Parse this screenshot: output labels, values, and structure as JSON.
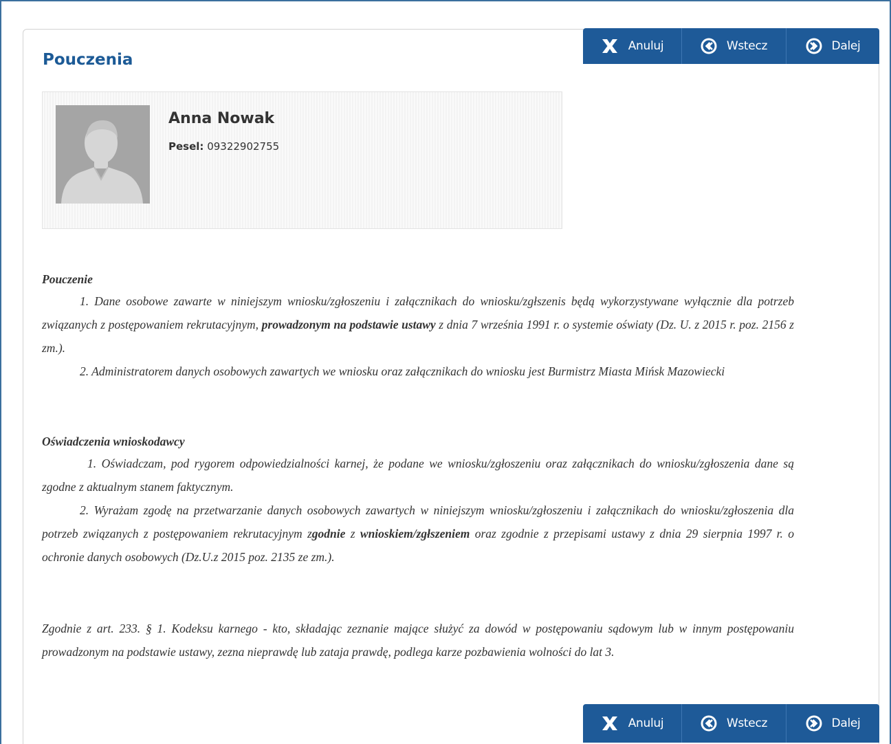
{
  "page": {
    "title": "Pouczenia"
  },
  "toolbar": {
    "cancel_label": "Anuluj",
    "back_label": "Wstecz",
    "next_label": "Dalej"
  },
  "profile": {
    "name": "Anna Nowak",
    "pesel_label": "Pesel:",
    "pesel_value": "09322902755"
  },
  "pouczenie": {
    "heading": "Pouczenie",
    "item1_a": "1. Dane osobowe zawarte w niniejszym wniosku/zgłoszeniu i załącznikach do wniosku/zgłszenis będą wykorzystywane wyłącznie dla potrzeb związanych z postępowaniem rekrutacyjnym, ",
    "item1_b": "prowadzonym na podstawie ustawy",
    "item1_c": "  z dnia 7 września 1991 r. o systemie oświaty (Dz. U. z 2015 r. poz. 2156 z zm.).",
    "item2": "2. Administratorem danych osobowych zawartych we wniosku oraz załącznikach do wniosku jest Burmistrz Miasta Mińsk Mazowiecki"
  },
  "oswiadczenia": {
    "heading": "Oświadczenia wnioskodawcy",
    "item1": "1.  Oświadczam, pod rygorem odpowiedzialności karnej, że podane we wniosku/zgłoszeniu oraz załącznikach do wniosku/zgłoszenia dane są zgodne z aktualnym stanem faktycznym.",
    "item2_a": "2.  Wyrażam zgodę na przetwarzanie danych osobowych zawartych w niniejszym wniosku/zgłoszeniu i załącznikach do wniosku/zgłoszenia dla potrzeb związanych z postępowaniem rekrutacyjnym z",
    "item2_b": "godnie",
    "item2_c": " z ",
    "item2_d": "wnioskiem/zgłszeniem",
    "item2_e": " oraz zgodnie z przepisami ustawy z dnia 29 sierpnia 1997 r. o ochronie danych osobowych (Dz.U.z 2015 poz. 2135 ze zm.)."
  },
  "kodeks": {
    "text": "Zgodnie z art. 233. § 1. Kodeksu  karnego - kto, składając zeznanie mające służyć za dowód w postępowaniu sądowym lub w innym  postępowaniu  prowadzonym  na podstawie ustawy, zezna  nieprawdę lub zataja prawdę, podlega  karze pozbawienia wolności do lat 3."
  },
  "colors": {
    "accent": "#1e5a98",
    "title": "#1c5a96",
    "frame": "#3b6f9e"
  },
  "icons": {
    "cancel": "close-icon",
    "back": "circle-chevron-left-icon",
    "next": "circle-chevron-right-icon",
    "avatar": "user-silhouette-icon"
  }
}
